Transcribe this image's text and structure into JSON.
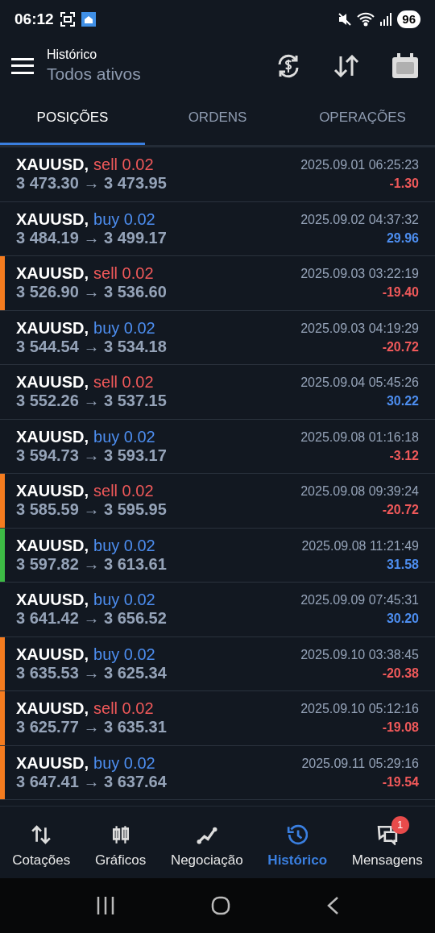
{
  "status_bar": {
    "time": "06:12",
    "battery": "96"
  },
  "header": {
    "title": "Histórico",
    "subtitle": "Todos ativos"
  },
  "tabs": [
    {
      "label": "POSIÇÕES",
      "selected": true
    },
    {
      "label": "ORDENS",
      "selected": false
    },
    {
      "label": "OPERAÇÕES",
      "selected": false
    }
  ],
  "positions": [
    {
      "symbol": "XAUUSD,",
      "deal": "sell 0.02",
      "kind": "sell",
      "prices": "3 473.30 → 3 473.95",
      "time": "2025.09.01 06:25:23",
      "profit": {
        "value": "-1.30",
        "kind": "loss"
      }
    },
    {
      "symbol": "XAUUSD,",
      "deal": "buy 0.02",
      "kind": "buy",
      "prices": "3 484.19 → 3 499.17",
      "time": "2025.09.02 04:37:32",
      "profit": {
        "value": "29.96",
        "kind": "gain"
      }
    },
    {
      "symbol": "XAUUSD,",
      "deal": "sell 0.02",
      "kind": "sell",
      "prices": "3 526.90 → 3 536.60",
      "time": "2025.09.03 03:22:19",
      "profit": {
        "value": "-19.40",
        "kind": "loss"
      },
      "color": "#f57c1f"
    },
    {
      "symbol": "XAUUSD,",
      "deal": "buy 0.02",
      "kind": "buy",
      "prices": "3 544.54 → 3 534.18",
      "time": "2025.09.03 04:19:29",
      "profit": {
        "value": "-20.72",
        "kind": "loss"
      }
    },
    {
      "symbol": "XAUUSD,",
      "deal": "sell 0.02",
      "kind": "sell",
      "prices": "3 552.26 → 3 537.15",
      "time": "2025.09.04 05:45:26",
      "profit": {
        "value": "30.22",
        "kind": "gain"
      }
    },
    {
      "symbol": "XAUUSD,",
      "deal": "buy 0.02",
      "kind": "buy",
      "prices": "3 594.73 → 3 593.17",
      "time": "2025.09.08 01:16:18",
      "profit": {
        "value": "-3.12",
        "kind": "loss"
      }
    },
    {
      "symbol": "XAUUSD,",
      "deal": "sell 0.02",
      "kind": "sell",
      "prices": "3 585.59 → 3 595.95",
      "time": "2025.09.08 09:39:24",
      "profit": {
        "value": "-20.72",
        "kind": "loss"
      },
      "color": "#f57c1f"
    },
    {
      "symbol": "XAUUSD,",
      "deal": "buy 0.02",
      "kind": "buy",
      "prices": "3 597.82 → 3 613.61",
      "time": "2025.09.08 11:21:49",
      "profit": {
        "value": "31.58",
        "kind": "gain"
      },
      "color": "#3dbb45"
    },
    {
      "symbol": "XAUUSD,",
      "deal": "buy 0.02",
      "kind": "buy",
      "prices": "3 641.42 → 3 656.52",
      "time": "2025.09.09 07:45:31",
      "profit": {
        "value": "30.20",
        "kind": "gain"
      }
    },
    {
      "symbol": "XAUUSD,",
      "deal": "buy 0.02",
      "kind": "buy",
      "prices": "3 635.53 → 3 625.34",
      "time": "2025.09.10 03:38:45",
      "profit": {
        "value": "-20.38",
        "kind": "loss"
      },
      "color": "#f57c1f"
    },
    {
      "symbol": "XAUUSD,",
      "deal": "sell 0.02",
      "kind": "sell",
      "prices": "3 625.77 → 3 635.31",
      "time": "2025.09.10 05:12:16",
      "profit": {
        "value": "-19.08",
        "kind": "loss"
      },
      "color": "#f57c1f"
    },
    {
      "symbol": "XAUUSD,",
      "deal": "buy 0.02",
      "kind": "buy",
      "prices": "3 647.41 → 3 637.64",
      "time": "2025.09.11 05:29:16",
      "profit": {
        "value": "-19.54",
        "kind": "loss"
      },
      "color": "#f57c1f"
    }
  ],
  "bottom_nav": [
    {
      "label": "Cotações",
      "selected": false
    },
    {
      "label": "Gráficos",
      "selected": false
    },
    {
      "label": "Negociação",
      "selected": false
    },
    {
      "label": "Histórico",
      "selected": true
    },
    {
      "label": "Mensagens",
      "selected": false,
      "badge": "1"
    }
  ]
}
